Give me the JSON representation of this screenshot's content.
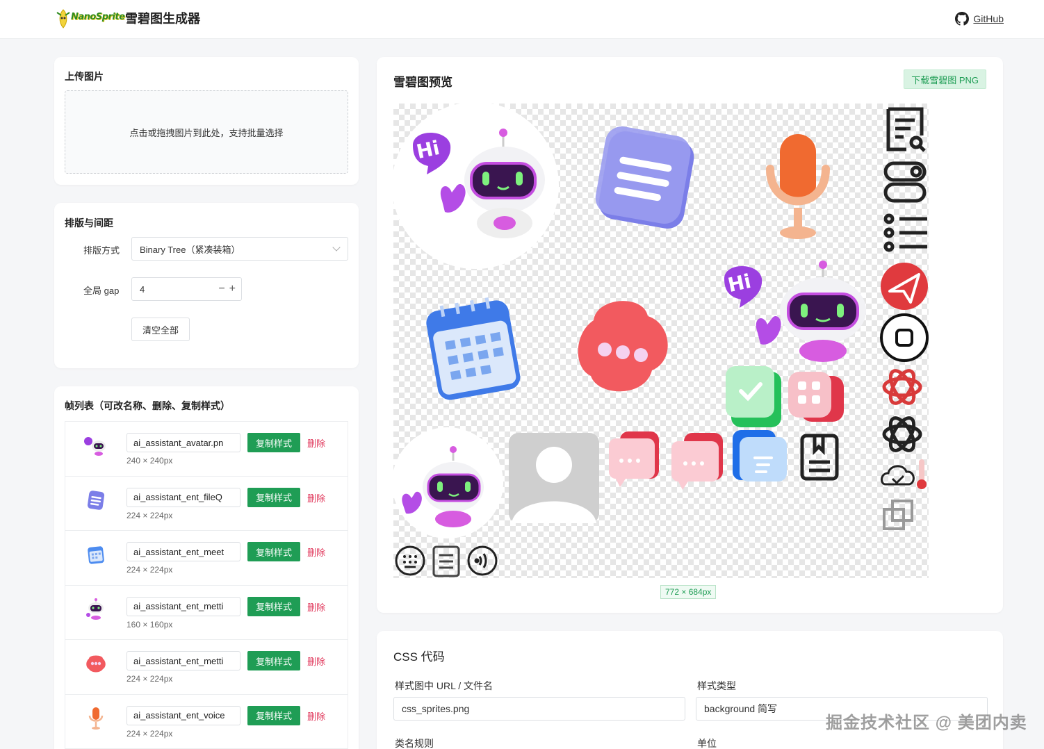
{
  "header": {
    "logo_text": "NanoSprite",
    "title": "雪碧图生成器",
    "github_label": "GitHub"
  },
  "upload": {
    "title": "上传图片",
    "dropzone_text": "点击或拖拽图片到此处，支持批量选择"
  },
  "layout": {
    "title": "排版与间距",
    "mode_label": "排版方式",
    "mode_value": "Binary Tree（紧凑装箱）",
    "gap_label": "全局 gap",
    "gap_value": "4",
    "clear_label": "清空全部"
  },
  "frames": {
    "title": "帧列表（可改名称、删除、复制样式）",
    "copy_label": "复制样式",
    "delete_label": "删除",
    "items": [
      {
        "name": "ai_assistant_avatar.pn",
        "size": "240 × 240px",
        "icon": "robot-hi-icon"
      },
      {
        "name": "ai_assistant_ent_fileQ",
        "size": "224 × 224px",
        "icon": "file-icon"
      },
      {
        "name": "ai_assistant_ent_meet",
        "size": "224 × 224px",
        "icon": "calendar-icon"
      },
      {
        "name": "ai_assistant_ent_metti",
        "size": "160 × 160px",
        "icon": "robot-icon"
      },
      {
        "name": "ai_assistant_ent_metti",
        "size": "224 × 224px",
        "icon": "chat-bubble-icon"
      },
      {
        "name": "ai_assistant_ent_voice",
        "size": "224 × 224px",
        "icon": "microphone-icon"
      }
    ]
  },
  "preview": {
    "title": "雪碧图预览",
    "download_label": "下载雪碧图 PNG",
    "dimensions": "772 × 684px"
  },
  "css": {
    "title": "CSS 代码",
    "url_label": "样式图中 URL / 文件名",
    "url_value": "css_sprites.png",
    "type_label": "样式类型",
    "type_value": "background 简写",
    "class_label": "类名规则",
    "unit_label": "单位"
  },
  "watermark": "掘金技术社区 @ 美团内卖",
  "colors": {
    "accent_green": "#1f9d55",
    "delete_red": "#e0365a"
  }
}
